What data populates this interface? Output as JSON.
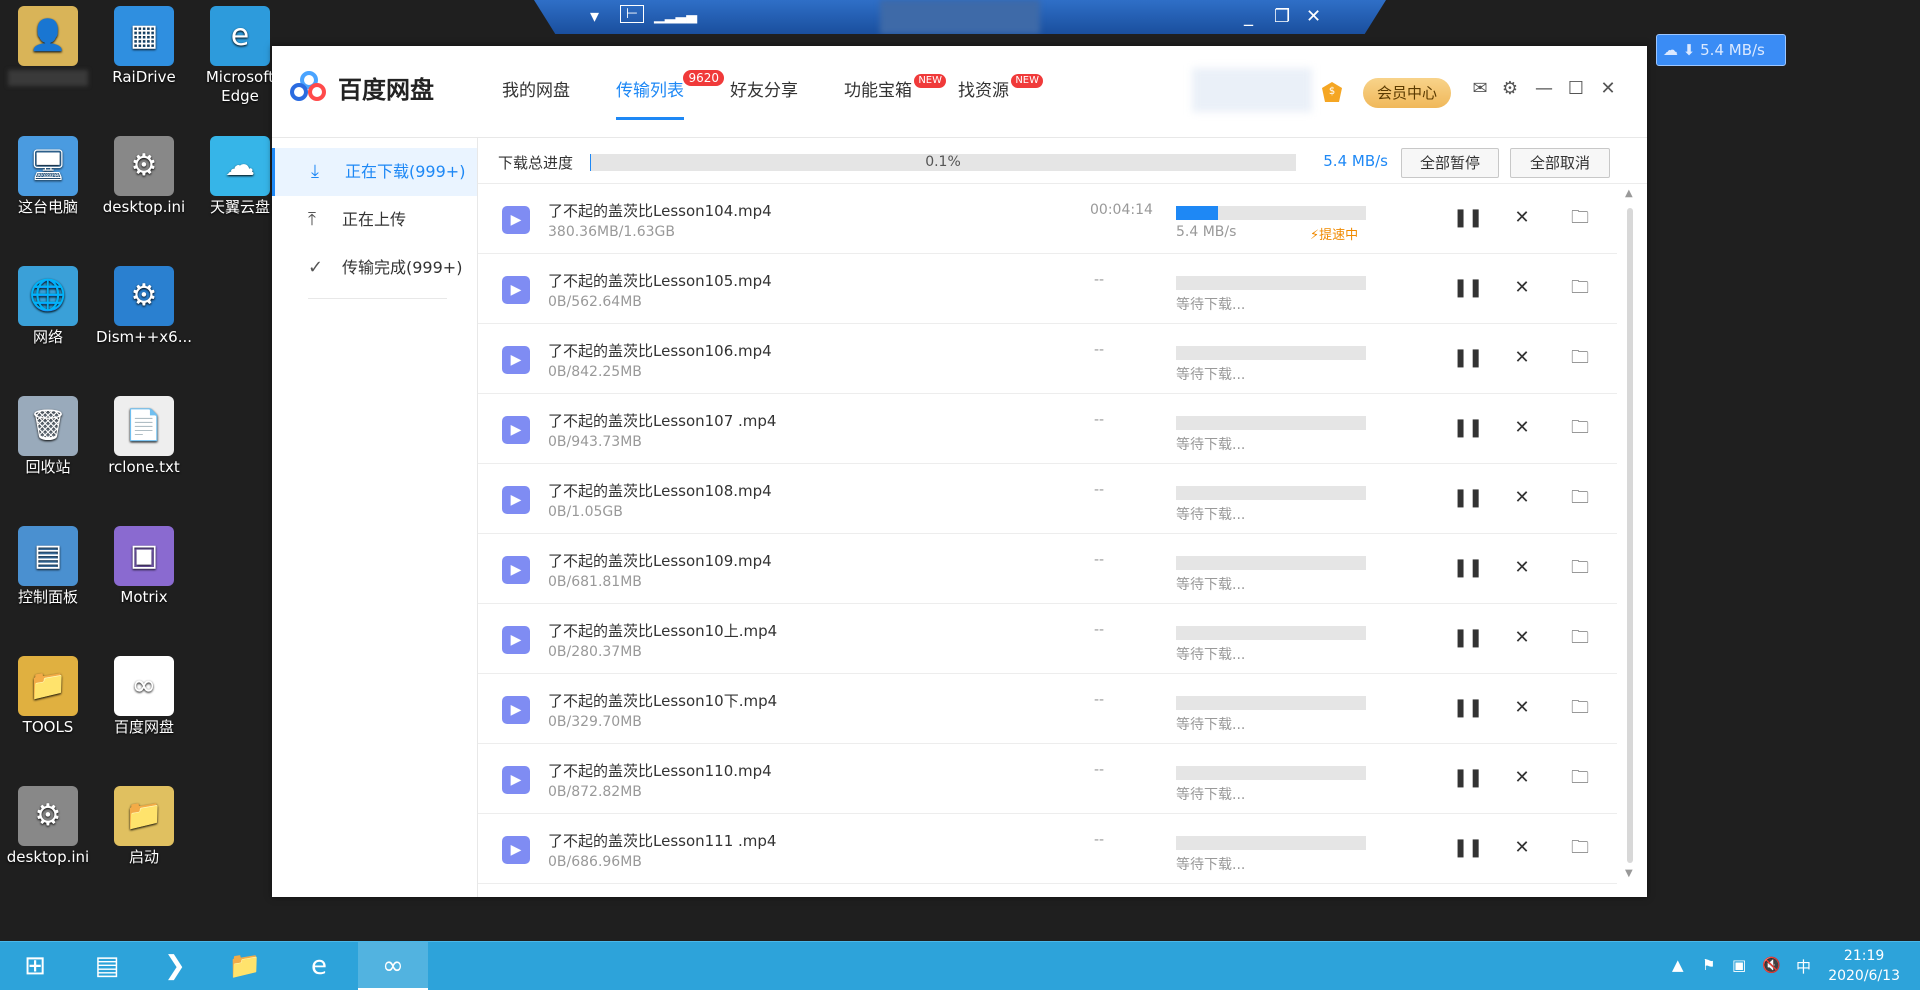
{
  "desktop": {
    "icons": [
      {
        "label": "",
        "glyph": "👤"
      },
      {
        "label": "RaiDrive",
        "glyph": "▦"
      },
      {
        "label": "Microsoft Edge",
        "glyph": "e"
      },
      {
        "label": "这台电脑",
        "glyph": "🖥"
      },
      {
        "label": "desktop.ini",
        "glyph": "⚙"
      },
      {
        "label": "天翼云盘",
        "glyph": "☁"
      },
      {
        "label": "网络",
        "glyph": "🌐"
      },
      {
        "label": "Dism++x6...",
        "glyph": "⚙"
      },
      {
        "label": "回收站",
        "glyph": "🗑"
      },
      {
        "label": "rclone.txt",
        "glyph": "📄"
      },
      {
        "label": "控制面板",
        "glyph": "▤"
      },
      {
        "label": "Motrix",
        "glyph": "▣"
      },
      {
        "label": "TOOLS",
        "glyph": "📁"
      },
      {
        "label": "百度网盘",
        "glyph": "∞"
      },
      {
        "label": "desktop.ini",
        "glyph": "⚙"
      },
      {
        "label": "启动",
        "glyph": "📁"
      }
    ]
  },
  "float_speed": "5.4 MB/s",
  "app": {
    "title": "百度网盘",
    "nav": [
      {
        "label": "我的网盘"
      },
      {
        "label": "传输列表",
        "badge": "9620"
      },
      {
        "label": "好友分享"
      },
      {
        "label": "功能宝箱",
        "badge": "NEW"
      },
      {
        "label": "找资源",
        "badge": "NEW"
      }
    ],
    "vip_label": "会员中心",
    "vip_icon_text": "$",
    "sidebar": [
      {
        "label": "正在下载(999+)",
        "icon": "download-icon"
      },
      {
        "label": "正在上传",
        "icon": "upload-icon"
      },
      {
        "label": "传输完成(999+)",
        "icon": "check-circle-icon"
      }
    ],
    "total": {
      "label": "下载总进度",
      "percent_text": "0.1%",
      "progress": 0.001,
      "speed": "5.4 MB/s",
      "pause_all": "全部暂停",
      "cancel_all": "全部取消"
    },
    "downloads": [
      {
        "name": "了不起的盖茨比Lesson104.mp4",
        "size": "380.36MB/1.63GB",
        "time": "00:04:14",
        "status": "5.4 MB/s",
        "boost": "提速中",
        "progress": 0.22
      },
      {
        "name": "了不起的盖茨比Lesson105.mp4",
        "size": "0B/562.64MB",
        "time": "--",
        "status": "等待下载...",
        "boost": "",
        "progress": 0
      },
      {
        "name": "了不起的盖茨比Lesson106.mp4",
        "size": "0B/842.25MB",
        "time": "--",
        "status": "等待下载...",
        "boost": "",
        "progress": 0
      },
      {
        "name": "了不起的盖茨比Lesson107 .mp4",
        "size": "0B/943.73MB",
        "time": "--",
        "status": "等待下载...",
        "boost": "",
        "progress": 0
      },
      {
        "name": "了不起的盖茨比Lesson108.mp4",
        "size": "0B/1.05GB",
        "time": "--",
        "status": "等待下载...",
        "boost": "",
        "progress": 0
      },
      {
        "name": "了不起的盖茨比Lesson109.mp4",
        "size": "0B/681.81MB",
        "time": "--",
        "status": "等待下载...",
        "boost": "",
        "progress": 0
      },
      {
        "name": "了不起的盖茨比Lesson10上.mp4",
        "size": "0B/280.37MB",
        "time": "--",
        "status": "等待下载...",
        "boost": "",
        "progress": 0
      },
      {
        "name": "了不起的盖茨比Lesson10下.mp4",
        "size": "0B/329.70MB",
        "time": "--",
        "status": "等待下载...",
        "boost": "",
        "progress": 0
      },
      {
        "name": "了不起的盖茨比Lesson110.mp4",
        "size": "0B/872.82MB",
        "time": "--",
        "status": "等待下载...",
        "boost": "",
        "progress": 0
      },
      {
        "name": "了不起的盖茨比Lesson111 .mp4",
        "size": "0B/686.96MB",
        "time": "--",
        "status": "等待下载...",
        "boost": "",
        "progress": 0
      }
    ]
  },
  "taskbar": {
    "ime": "中",
    "time": "21:19",
    "date": "2020/6/13"
  },
  "colors": {
    "accent": "#1e88f5",
    "taskbar": "#2da3da",
    "badge": "#f03a3a",
    "boost": "#f08a00"
  }
}
